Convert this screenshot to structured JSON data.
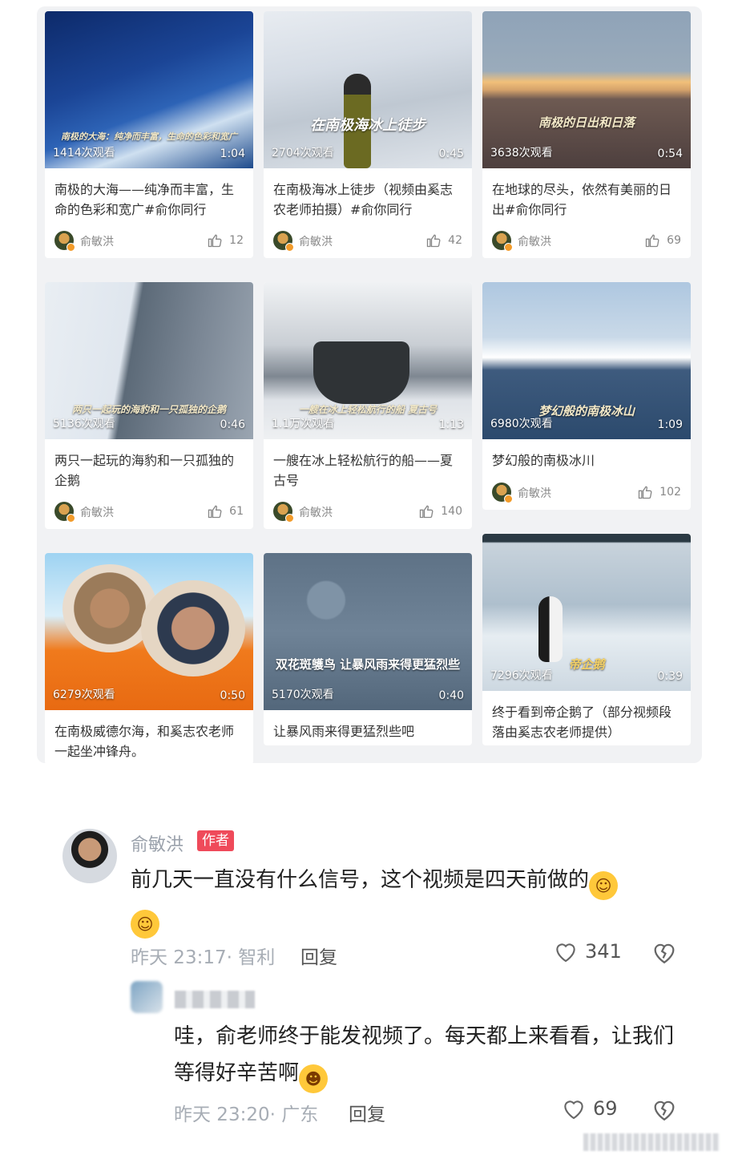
{
  "grid": {
    "cards": [
      {
        "caption": "南极的大海：纯净而丰富，生命的色彩和宽广",
        "views": "1414次观看",
        "duration": "1:04",
        "title": "南极的大海——纯净而丰富，生命的色彩和宽广#俞你同行",
        "author": "俞敏洪",
        "likes": "12"
      },
      {
        "caption": "在南极海冰上徒步",
        "views": "2704次观看",
        "duration": "0:45",
        "title": "在南极海冰上徒步（视频由奚志农老师拍摄）#俞你同行",
        "author": "俞敏洪",
        "likes": "42"
      },
      {
        "caption": "南极的日出和日落",
        "views": "3638次观看",
        "duration": "0:54",
        "title": "在地球的尽头，依然有美丽的日出#俞你同行",
        "author": "俞敏洪",
        "likes": "69"
      },
      {
        "caption": "两只一起玩的海豹和一只孤独的企鹅",
        "views": "5136次观看",
        "duration": "0:46",
        "title": "两只一起玩的海豹和一只孤独的企鹅",
        "author": "俞敏洪",
        "likes": "61"
      },
      {
        "caption": "一艘在冰上轻松航行的船 夏古号",
        "views": "1.1万次观看",
        "duration": "1:13",
        "title": "一艘在冰上轻松航行的船——夏古号",
        "author": "俞敏洪",
        "likes": "140"
      },
      {
        "caption": "梦幻般的南极冰山",
        "views": "6980次观看",
        "duration": "1:09",
        "title": "梦幻般的南极冰川",
        "author": "俞敏洪",
        "likes": "102"
      },
      {
        "caption": "",
        "views": "6279次观看",
        "duration": "0:50",
        "title": "在南极威德尔海，和奚志农老师一起坐冲锋舟。",
        "author": "",
        "likes": ""
      },
      {
        "caption": "双花斑鹱鸟 让暴风雨来得更猛烈些",
        "views": "5170次观看",
        "duration": "0:40",
        "title": "让暴风雨来得更猛烈些吧",
        "author": "",
        "likes": ""
      },
      {
        "caption": "帝企鹅",
        "views": "7296次观看",
        "duration": "0:39",
        "title": "终于看到帝企鹅了（部分视频段落由奚志农老师提供）",
        "author": "",
        "likes": ""
      }
    ]
  },
  "comment": {
    "name": "俞敏洪",
    "badge": "作者",
    "text": "前几天一直没有什么信号，这个视频是四天前做的",
    "time": "昨天 23:17· 智利",
    "reply": "回复",
    "likes": "341"
  },
  "subcomment": {
    "text": "哇，俞老师终于能发视频了。每天都上来看看，让我们等得好辛苦啊",
    "time": "昨天 23:20· 广东",
    "reply": "回复",
    "likes": "69"
  },
  "icons": {
    "emoji": "laughing-crying-emoji",
    "grin": "grinning-emoji"
  }
}
